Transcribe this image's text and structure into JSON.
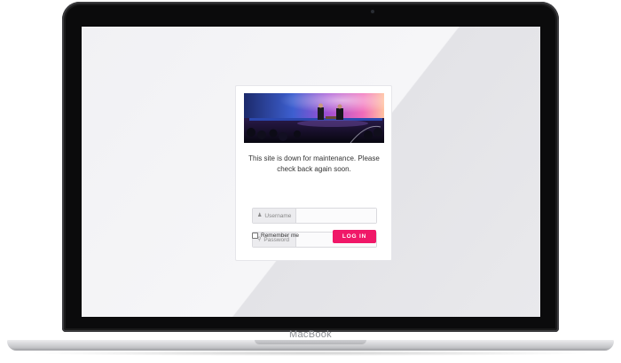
{
  "device": {
    "model_label": "MacBook"
  },
  "maintenance": {
    "message": "This site is down for maintenance. Please check back again soon."
  },
  "login_form": {
    "username": {
      "icon": "user-icon",
      "placeholder": "Username",
      "value": ""
    },
    "password": {
      "icon": "key-icon",
      "placeholder": "Password",
      "value": ""
    },
    "remember_label": "Remember me",
    "remember_checked": false,
    "submit_label": "LOG IN"
  },
  "colors": {
    "accent": "#f01868",
    "screen_background": "#f1f1f4",
    "card_border": "#e6e6ea"
  }
}
